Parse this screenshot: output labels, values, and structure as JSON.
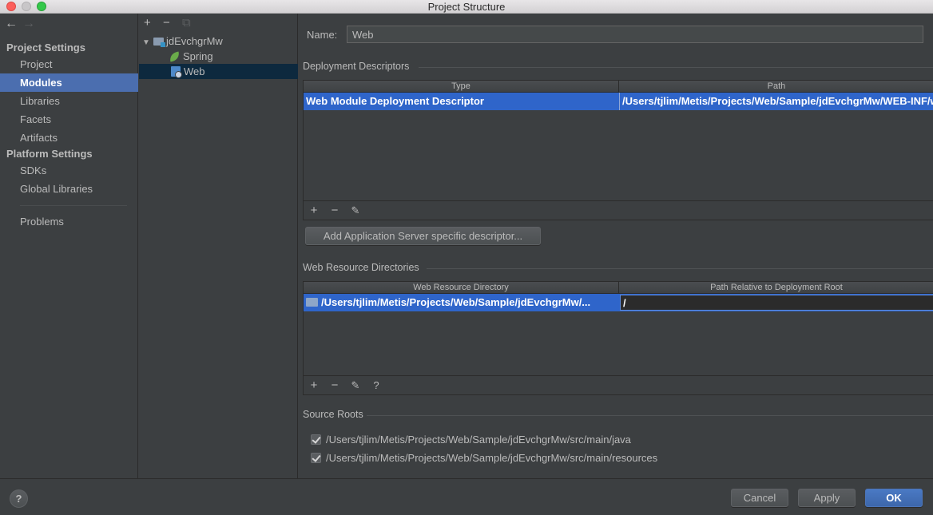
{
  "window": {
    "title": "Project Structure"
  },
  "nav": {
    "back_icon": "←",
    "forward_icon": "→"
  },
  "sidebar": {
    "project_settings_header": "Project Settings",
    "project_items": [
      "Project",
      "Modules",
      "Libraries",
      "Facets",
      "Artifacts"
    ],
    "platform_settings_header": "Platform Settings",
    "platform_items": [
      "SDKs",
      "Global Libraries"
    ],
    "problems": "Problems",
    "selected": "Modules"
  },
  "tree": {
    "toolbar": {
      "add": "+",
      "remove": "−",
      "copy": "⧉"
    },
    "root": "jdEvchgrMw",
    "children": [
      "Spring",
      "Web"
    ],
    "selected": "Web"
  },
  "main": {
    "name_label": "Name:",
    "name_value": "Web",
    "deployment": {
      "title": "Deployment Descriptors",
      "columns": [
        "Type",
        "Path"
      ],
      "rows": [
        {
          "type": "Web Module Deployment Descriptor",
          "path": "/Users/tjlim/Metis/Projects/Web/Sample/jdEvchgrMw/WEB-INF/web.xml"
        }
      ],
      "toolbar": {
        "add": "+",
        "remove": "−",
        "edit": "✎"
      },
      "add_server_button": "Add Application Server specific descriptor..."
    },
    "web_resources": {
      "title": "Web Resource Directories",
      "columns": [
        "Web Resource Directory",
        "Path Relative to Deployment Root"
      ],
      "rows": [
        {
          "directory": "/Users/tjlim/Metis/Projects/Web/Sample/jdEvchgrMw/...",
          "relative_path": "/"
        }
      ],
      "toolbar": {
        "add": "+",
        "remove": "−",
        "edit": "✎",
        "help": "?"
      }
    },
    "source_roots": {
      "title": "Source Roots",
      "items": [
        {
          "path": "/Users/tjlim/Metis/Projects/Web/Sample/jdEvchgrMw/src/main/java",
          "checked": true
        },
        {
          "path": "/Users/tjlim/Metis/Projects/Web/Sample/jdEvchgrMw/src/main/resources",
          "checked": true
        }
      ]
    }
  },
  "footer": {
    "help": "?",
    "cancel": "Cancel",
    "apply": "Apply",
    "ok": "OK"
  },
  "colors": {
    "background": "#3c3f41",
    "selection": "#4b6eaf",
    "table_selection": "#2f65ca",
    "primary_button": "#3d67ab"
  }
}
